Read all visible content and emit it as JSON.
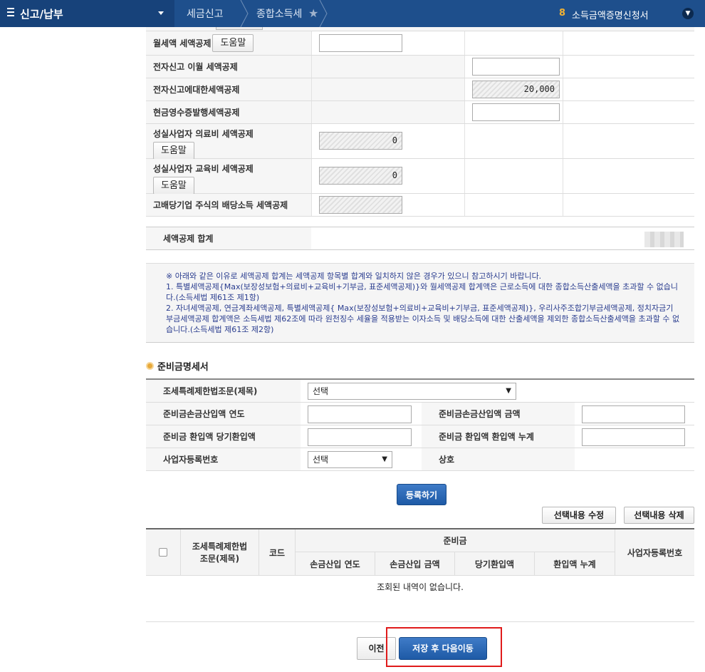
{
  "topnav": {
    "menu": "신고/납부",
    "crumb1": "세금신고",
    "crumb2": "종합소득세",
    "cert_count": "8",
    "cert_label": "소득금액증명신청서"
  },
  "deductions": {
    "rows": [
      {
        "label": "월세액 세액공제",
        "help": "도움말"
      },
      {
        "label": "전자신고 이월 세액공제"
      },
      {
        "label": "전자신고에대한세액공제",
        "value": "20,000"
      },
      {
        "label": "현금영수증발행세액공제"
      },
      {
        "label": "성실사업자 의료비 세액공제",
        "help": "도움말",
        "value": "0"
      },
      {
        "label": "성실사업자 교육비 세액공제",
        "help": "도움말",
        "value": "0"
      },
      {
        "label": "고배당기업 주식의 배당소득 세액공제"
      }
    ],
    "total_label": "세액공제 합계"
  },
  "notice": {
    "line1": "※ 아래와 같은 이유로 세액공제 합계는 세액공제 항목별 합계와 일치하지 않은 경우가 있으니 참고하시기 바랍니다.",
    "line2": "1. 특별세액공제{Max(보장성보험+의료비+교육비+기부금, 표준세액공제)}와 월세액공제 합계액은 근로소득에 대한 종합소득산출세액을 초과할 수 없습니다.(소득세법 제61조 제1항)",
    "line3": "2. 자녀세액공제, 연금계좌세액공제, 특별세액공제{ Max(보장성보험+의료비+교육비+기부금, 표준세액공제)}, 우리사주조합기부금세액공제, 정치자금기부금세액공제 합계액은 소득세법 제62조에 따라 원천징수 세율을 적용받는 이자소득 및 배당소득에 대한 산출세액을 제외한 종합소득산출세액을 초과할 수 없습니다.(소득세법 제61조 제2항)"
  },
  "reserve": {
    "title": "준비금명세서",
    "law_label": "조세특례제한법조문(제목)",
    "law_select": "선택",
    "year_label": "준비금손금산입액 연도",
    "amount_label": "준비금손금산입액 금액",
    "refund_label": "준비금 환입액 당기환입액",
    "refund_cum_label": "준비금 환입액 환입액 누계",
    "bizno_label": "사업자등록번호",
    "bizno_select": "선택",
    "company_label": "상호",
    "register": "등록하기",
    "edit_selected": "선택내용 수정",
    "delete_selected": "선택내용 삭제"
  },
  "list": {
    "col_law": "조세특례제한법\n조문(제목)",
    "col_code": "코드",
    "col_reserve": "준비금",
    "col_year": "손금산입 연도",
    "col_amount": "손금산입 금액",
    "col_current": "당기환입액",
    "col_cum": "환입액 누계",
    "col_bizno": "사업자등록번호",
    "empty": "조회된 내역이 없습니다."
  },
  "footer": {
    "prev": "이전",
    "save_next": "저장 후 다음이동"
  }
}
